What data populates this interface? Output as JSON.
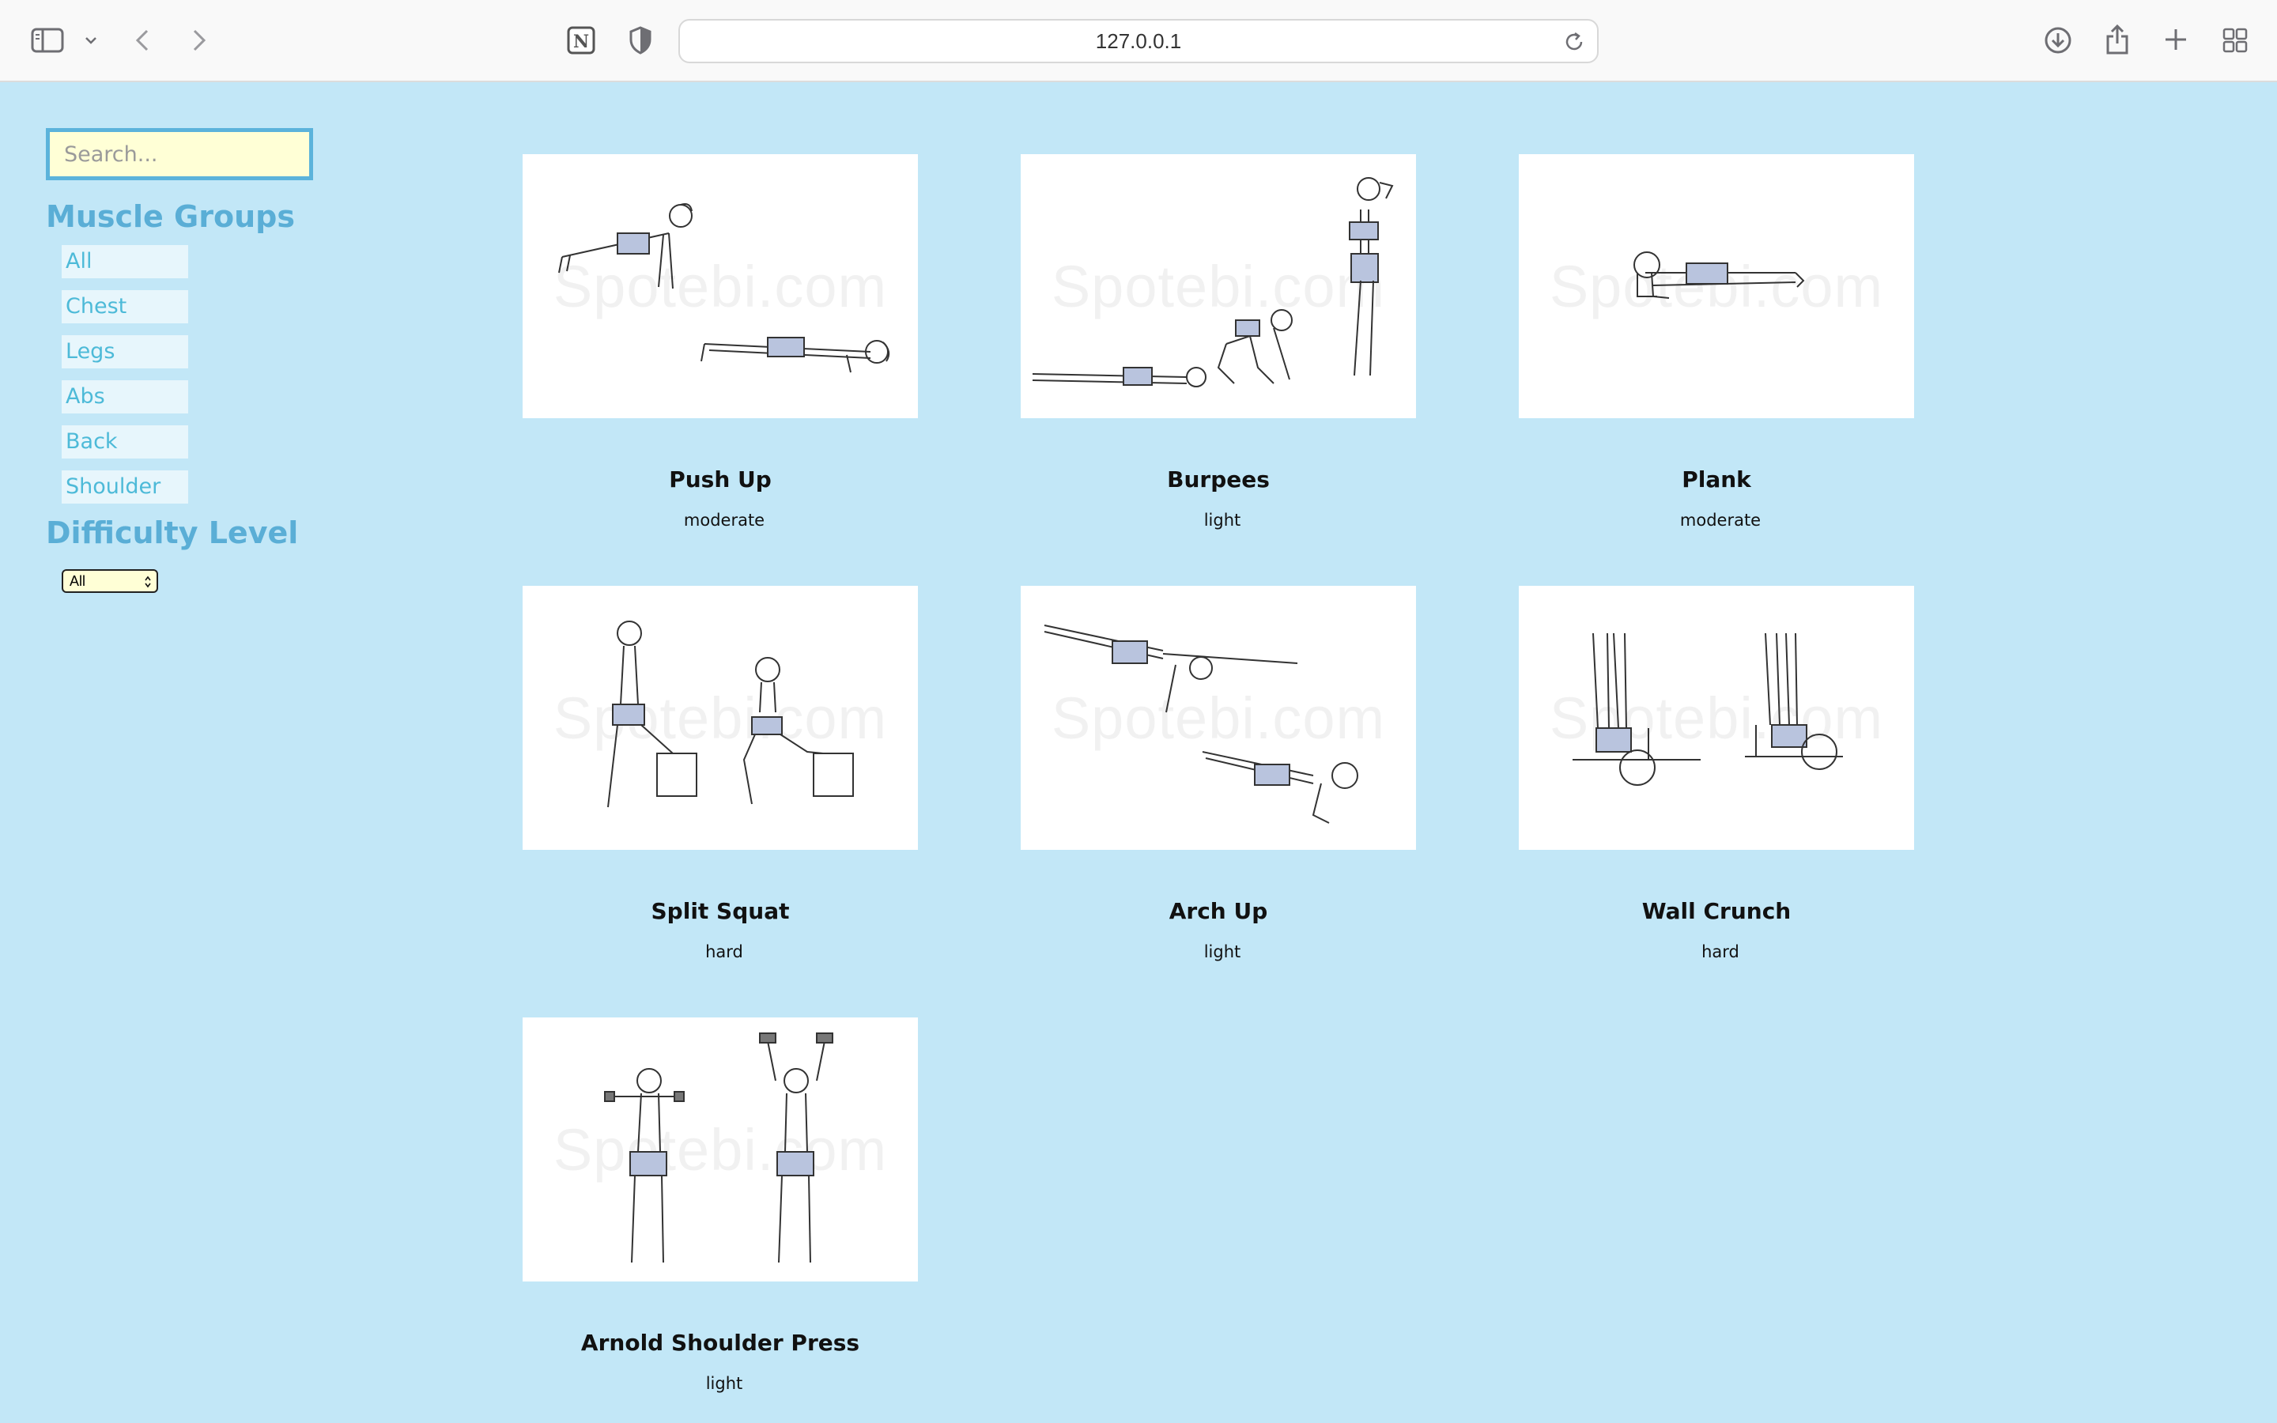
{
  "browser": {
    "url": "127.0.0.1"
  },
  "sidebar": {
    "search_placeholder": "Search...",
    "muscle_groups_heading": "Muscle Groups",
    "muscle_groups": [
      "All",
      "Chest",
      "Legs",
      "Abs",
      "Back",
      "Shoulder"
    ],
    "difficulty_heading": "Difficulty Level",
    "difficulty_selected": "All"
  },
  "exercises": [
    {
      "name": "Push Up",
      "level": "moderate",
      "watermark": "Spotebi.com"
    },
    {
      "name": "Burpees",
      "level": "light",
      "watermark": "Spotebi.com"
    },
    {
      "name": "Plank",
      "level": "moderate",
      "watermark": "Spotebi.com"
    },
    {
      "name": "Split Squat",
      "level": "hard",
      "watermark": "Spotebi.com"
    },
    {
      "name": "Arch Up",
      "level": "light",
      "watermark": "Spotebi.com"
    },
    {
      "name": "Wall Crunch",
      "level": "hard",
      "watermark": "Spotebi.com"
    },
    {
      "name": "Arnold Shoulder Press",
      "level": "light",
      "watermark": "Spotebi.com"
    }
  ],
  "colors": {
    "page_background": "#c2e7f7",
    "heading": "#5aaed6",
    "filter_button_bg": "#e7f6fc",
    "filter_button_text": "#4dbad8",
    "search_bg": "#ffffd6",
    "search_border": "#5bb3db"
  }
}
